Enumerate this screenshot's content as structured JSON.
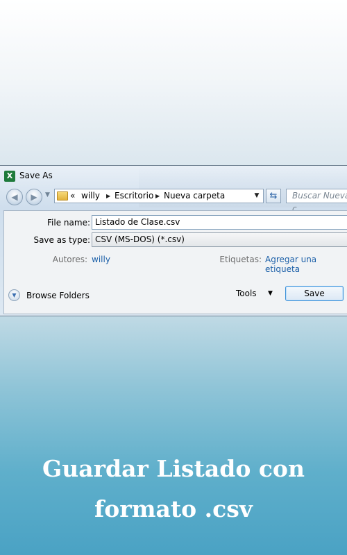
{
  "window": {
    "title": "Save As",
    "app_icon": "excel-icon"
  },
  "navbar": {
    "back_icon": "back-arrow-icon",
    "forward_icon": "forward-arrow-icon",
    "crumb_overflow": "«",
    "breadcrumbs": [
      "willy",
      "Escritorio",
      "Nueva carpeta"
    ],
    "search_placeholder": "Buscar Nueva c"
  },
  "form": {
    "file_name_label": "File name:",
    "file_name_value": "Listado de Clase.csv",
    "save_as_type_label": "Save as type:",
    "save_as_type_value": "CSV (MS-DOS) (*.csv)",
    "authors_label": "Autores:",
    "authors_value": "willy",
    "tags_label": "Etiquetas:",
    "tags_value": "Agregar una etiqueta"
  },
  "footer": {
    "browse_folders": "Browse Folders",
    "tools": "Tools",
    "save": "Save"
  },
  "caption": {
    "line1": "Guardar Listado con",
    "line2": "formato .csv"
  },
  "colors": {
    "link": "#1b5fa8",
    "accent_border": "#3d90d8",
    "caption_text": "#ffffff"
  }
}
